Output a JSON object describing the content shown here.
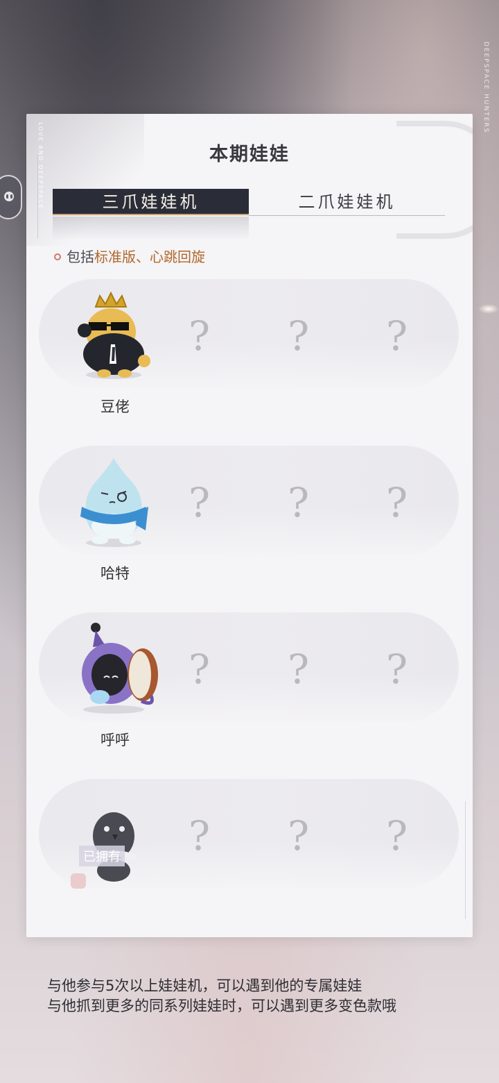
{
  "brand": {
    "vertical": "DEEPSPACE HUNTERS"
  },
  "modal": {
    "deco_text": "LOVE AND DEEPSPACE",
    "title": "本期娃娃",
    "tabs": [
      {
        "label": "三爪娃娃机",
        "active": true
      },
      {
        "label": "二爪娃娃机",
        "active": false
      }
    ],
    "note": {
      "prefix": "包括",
      "highlight": "标准版、心跳回旋"
    },
    "rows": [
      {
        "name": "豆佬",
        "owned": false,
        "locked": [
          "?",
          "?",
          "?"
        ]
      },
      {
        "name": "哈特",
        "owned": false,
        "locked": [
          "?",
          "?",
          "?"
        ]
      },
      {
        "name": "呼呼",
        "owned": false,
        "locked": [
          "?",
          "?",
          "?"
        ]
      },
      {
        "name": "",
        "owned": true,
        "owned_label": "已拥有",
        "locked": [
          "?",
          "?",
          "?"
        ]
      }
    ]
  },
  "footer": {
    "line1": "与他参与5次以上娃娃机，可以遇到他的专属娃娃",
    "line2": "与他抓到更多的同系列娃娃时，可以遇到更多变色款哦"
  },
  "colors": {
    "active_tab": "#2a2d38",
    "highlight": "#b0672c",
    "background": "#f5f4f6"
  }
}
